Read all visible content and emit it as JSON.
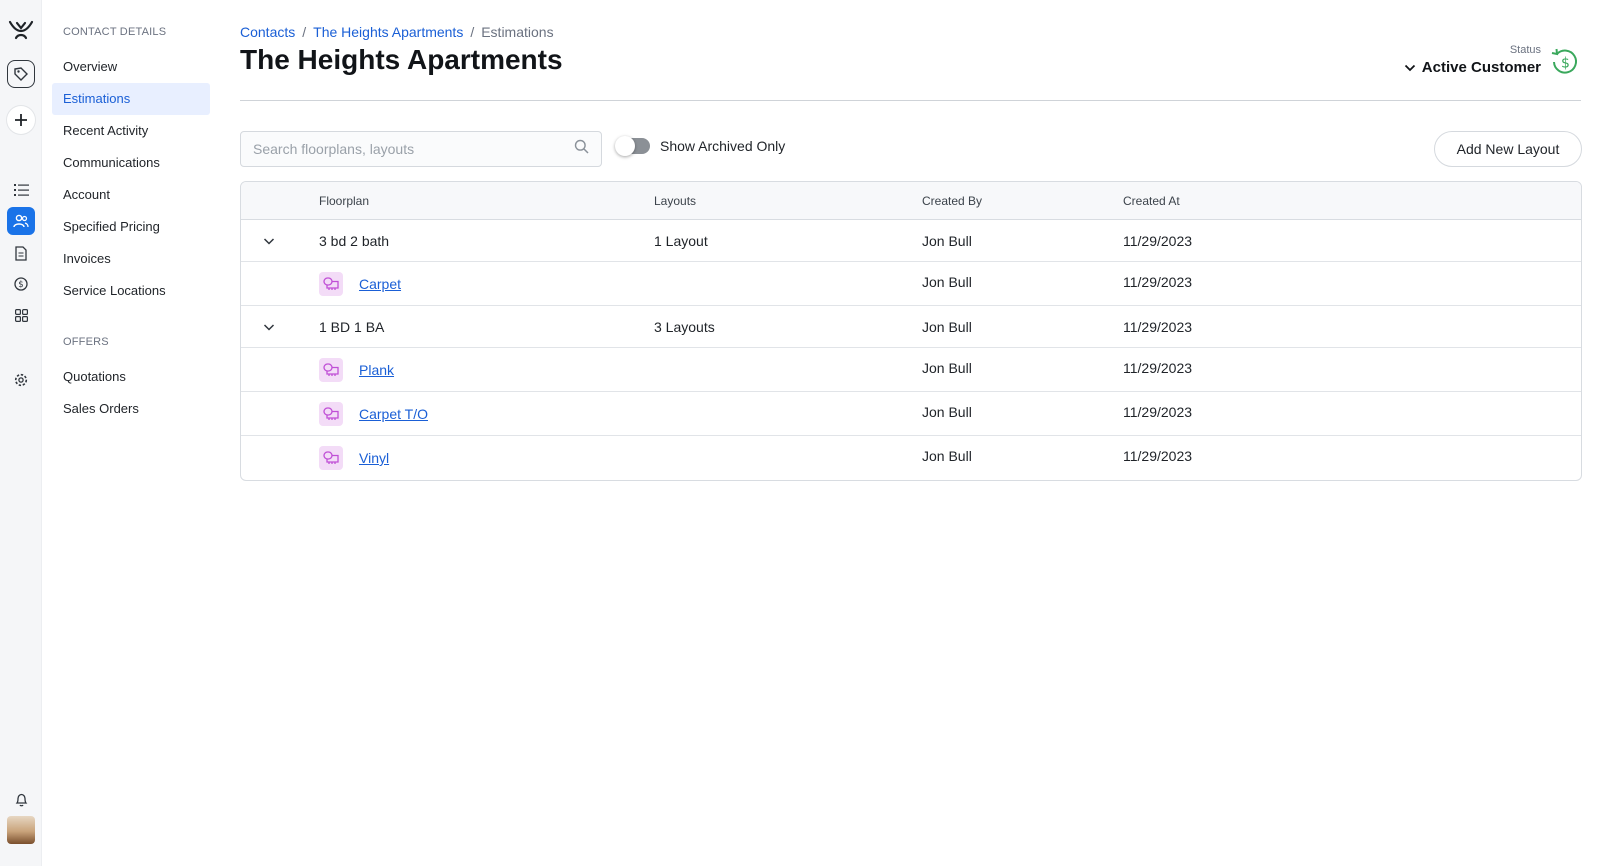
{
  "rail": {
    "icons": [
      "logo-icon",
      "tag-icon",
      "plus-icon",
      "list-icon",
      "contacts-icon",
      "document-icon",
      "dollar-icon",
      "apps-icon",
      "settings-icon",
      "bell-icon"
    ],
    "active": "contacts-icon"
  },
  "subnav": {
    "section1": "CONTACT DETAILS",
    "items1": [
      "Overview",
      "Estimations",
      "Recent Activity",
      "Communications",
      "Account",
      "Specified Pricing",
      "Invoices",
      "Service Locations"
    ],
    "active": "Estimations",
    "section2": "OFFERS",
    "items2": [
      "Quotations",
      "Sales Orders"
    ]
  },
  "breadcrumb": {
    "contacts": "Contacts",
    "separator": "/",
    "contact": "The Heights Apartments",
    "current": "Estimations"
  },
  "page_title": "The Heights Apartments",
  "status": {
    "label": "Status",
    "value": "Active Customer",
    "icon": "dollar-refresh-icon",
    "icon_color": "#3aa85c"
  },
  "toolbar": {
    "search_placeholder": "Search floorplans, layouts",
    "archived_label": "Show Archived Only",
    "archived_on": false,
    "add_label": "Add New Layout"
  },
  "table": {
    "columns": [
      "Floorplan",
      "Layouts",
      "Created By",
      "Created At"
    ],
    "groups": [
      {
        "floorplan": "3 bd 2 bath",
        "layouts": "1 Layout",
        "created_by": "Jon Bull",
        "created_at": "11/29/2023",
        "children": [
          {
            "name": "Carpet",
            "created_by": "Jon Bull",
            "created_at": "11/29/2023"
          }
        ]
      },
      {
        "floorplan": "1 BD 1 BA",
        "layouts": "3 Layouts",
        "created_by": "Jon Bull",
        "created_at": "11/29/2023",
        "children": [
          {
            "name": "Plank",
            "created_by": "Jon Bull",
            "created_at": "11/29/2023"
          },
          {
            "name": "Carpet T/O",
            "created_by": "Jon Bull",
            "created_at": "11/29/2023"
          },
          {
            "name": "Vinyl",
            "created_by": "Jon Bull",
            "created_at": "11/29/2023"
          }
        ]
      }
    ]
  },
  "colors": {
    "accent": "#1a73e8",
    "link": "#1a5fd6",
    "layout_icon_bg": "#f3dcf7",
    "layout_icon_fg": "#c04fd6"
  }
}
